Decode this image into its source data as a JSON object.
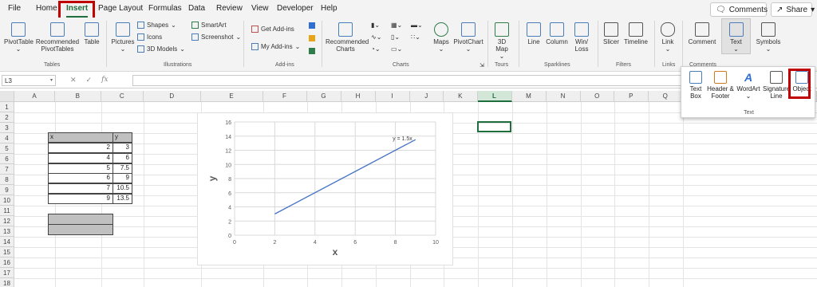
{
  "menu": {
    "tabs": [
      "File",
      "Home",
      "Insert",
      "Page Layout",
      "Formulas",
      "Data",
      "Review",
      "View",
      "Developer",
      "Help"
    ],
    "comments_label": "Comments",
    "share_label": "Share"
  },
  "ribbon": {
    "pivottable": "PivotTable",
    "recommended_pivottables": "Recommended PivotTables",
    "table": "Table",
    "group_tables": "Tables",
    "pictures": "Pictures",
    "shapes": "Shapes",
    "icons": "Icons",
    "models_3d": "3D Models",
    "smartart": "SmartArt",
    "screenshot": "Screenshot",
    "group_illustrations": "Illustrations",
    "get_addins": "Get Add-ins",
    "my_addins": "My Add-ins",
    "group_addins": "Add-ins",
    "recommended_charts": "Recommended Charts",
    "maps": "Maps",
    "pivotchart": "PivotChart",
    "group_charts": "Charts",
    "map_3d": "3D Map",
    "group_tours": "Tours",
    "line": "Line",
    "column": "Column",
    "winloss": "Win/ Loss",
    "group_sparklines": "Sparklines",
    "slicer": "Slicer",
    "timeline": "Timeline",
    "group_filters": "Filters",
    "link": "Link",
    "group_links": "Links",
    "comment": "Comment",
    "group_comments": "Comments",
    "text": "Text",
    "symbols": "Symbols"
  },
  "text_panel": {
    "text_box": "Text Box",
    "header_footer": "Header & Footer",
    "wordart": "WordArt",
    "signature_line": "Signature Line",
    "object": "Object",
    "group_label": "Text"
  },
  "formula_bar": {
    "name_box": "L3",
    "fx": "fx"
  },
  "columns": [
    "A",
    "B",
    "C",
    "D",
    "E",
    "F",
    "G",
    "H",
    "I",
    "J",
    "K",
    "L",
    "M",
    "N",
    "O",
    "P",
    "Q"
  ],
  "rows": [
    "1",
    "2",
    "3",
    "4",
    "5",
    "6",
    "7",
    "8",
    "9",
    "10",
    "11",
    "12",
    "13",
    "14",
    "15",
    "16",
    "17",
    "18"
  ],
  "table": {
    "header_x": "x",
    "header_y": "y",
    "x_values": [
      "2",
      "4",
      "5",
      "6",
      "7",
      "9"
    ],
    "y_values": [
      "3",
      "6",
      "7.5",
      "9",
      "10.5",
      "13.5"
    ]
  },
  "chart_data": {
    "type": "line",
    "x": [
      2,
      9
    ],
    "series": [
      {
        "values": [
          3,
          13.5
        ]
      }
    ],
    "xlabel": "x",
    "ylabel": "y",
    "xlim": [
      0,
      10
    ],
    "ylim": [
      0,
      16
    ],
    "x_ticks": [
      "0",
      "2",
      "4",
      "6",
      "8",
      "10"
    ],
    "y_ticks": [
      "0",
      "2",
      "4",
      "6",
      "8",
      "10",
      "12",
      "14",
      "16"
    ],
    "annotation": "y = 1.5x",
    "line_color": "#4472c4",
    "grid": true
  }
}
